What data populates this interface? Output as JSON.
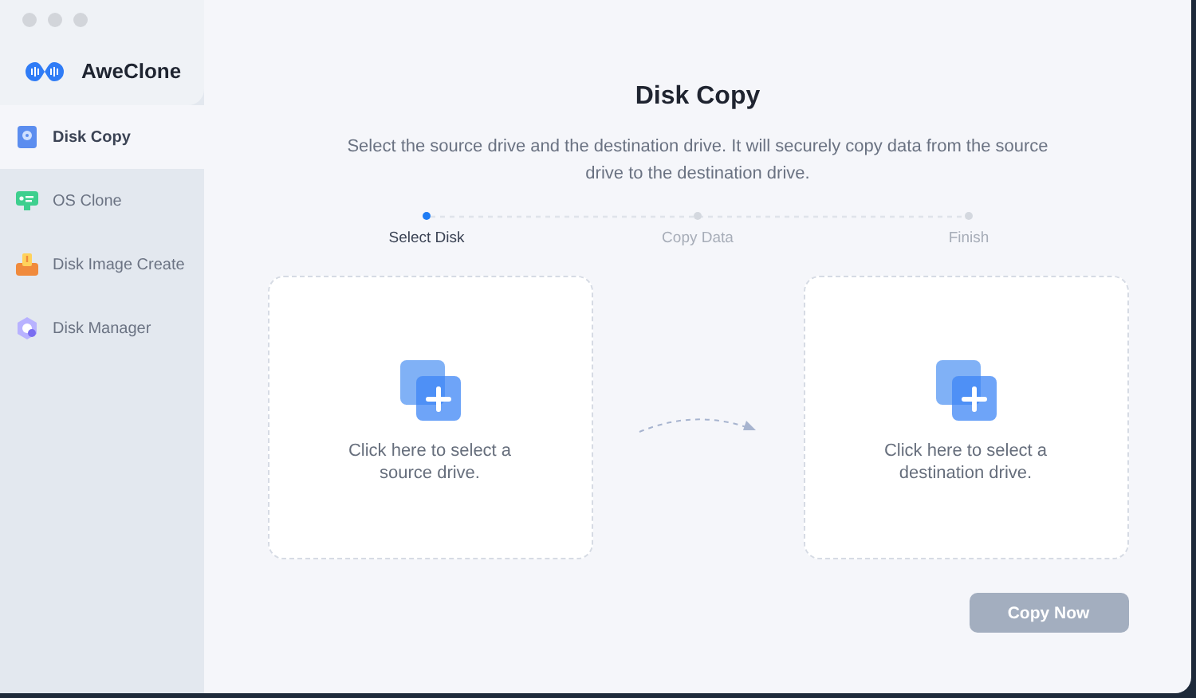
{
  "app": {
    "name": "AweClone"
  },
  "sidebar": {
    "items": [
      {
        "label": "Disk Copy",
        "selected": true,
        "kind": "copy"
      },
      {
        "label": "OS Clone",
        "selected": false,
        "kind": "os"
      },
      {
        "label": "Disk Image Create",
        "selected": false,
        "kind": "image"
      },
      {
        "label": "Disk Manager",
        "selected": false,
        "kind": "manager"
      }
    ]
  },
  "main": {
    "title": "Disk Copy",
    "description": "Select the source drive and the destination drive. It will securely copy data from the source drive to the destination drive.",
    "steps": [
      {
        "label": "Select Disk",
        "active": true
      },
      {
        "label": "Copy Data",
        "active": false
      },
      {
        "label": "Finish",
        "active": false
      }
    ],
    "drives": [
      {
        "label": "Click here to select a source drive."
      },
      {
        "label": "Click here to select a destination drive."
      }
    ],
    "button": {
      "label": "Copy Now",
      "disabled": true
    }
  }
}
